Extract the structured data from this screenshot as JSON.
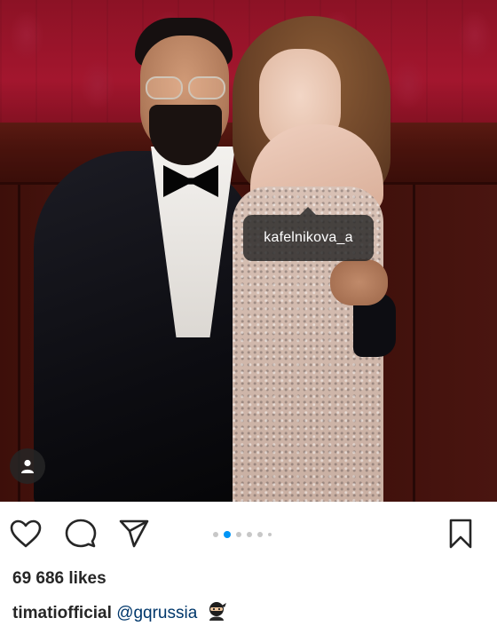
{
  "photo": {
    "tag_username": "kafelnikova_a",
    "user_tag_icon": "person-icon"
  },
  "actions": {
    "like_icon": "heart-icon",
    "comment_icon": "comment-bubble-icon",
    "share_icon": "paper-plane-icon",
    "save_icon": "bookmark-icon",
    "carousel": {
      "total": 6,
      "active_index": 1
    }
  },
  "post": {
    "likes": "69 686 likes",
    "author": "timatiofficial",
    "mention": "@gqrussia",
    "emoji_icon": "ninja-emoji"
  },
  "colors": {
    "accent_blue": "#0095f6",
    "text": "#262626",
    "mention": "#00376b"
  }
}
